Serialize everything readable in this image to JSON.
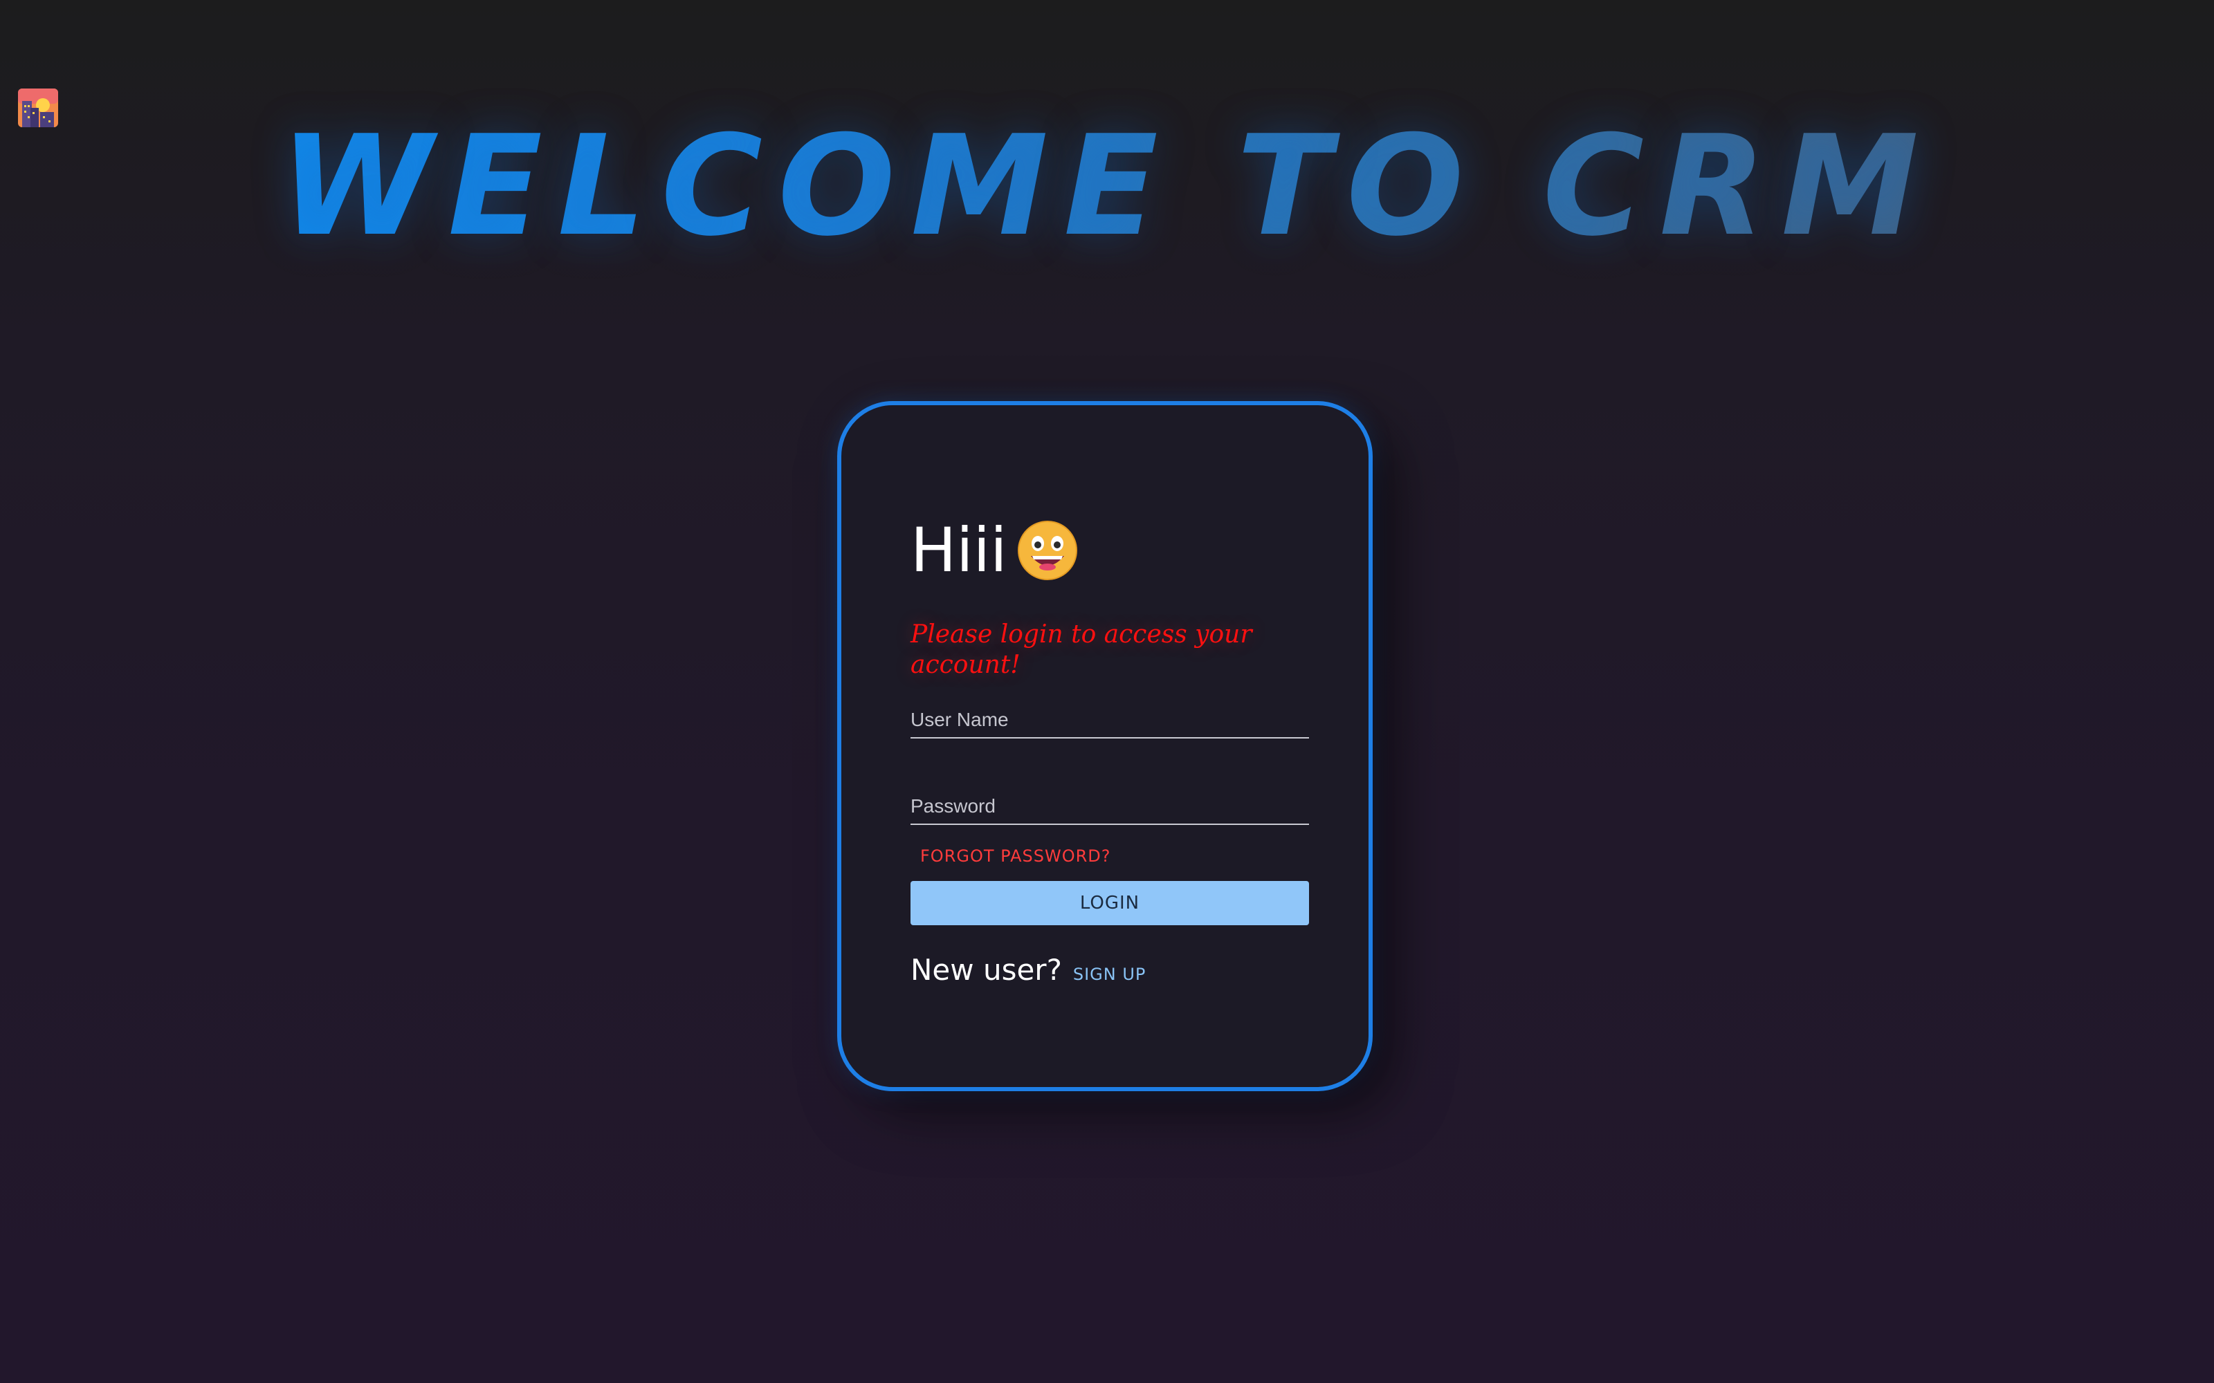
{
  "header": {
    "title": "WELCOME TO CRM",
    "logo_icon": "city-sunset-icon"
  },
  "login_card": {
    "greeting": "Hiii",
    "greeting_icon": "grinning-face-icon",
    "subtitle": "Please login to access your account!",
    "username": {
      "placeholder": "User Name",
      "value": ""
    },
    "password": {
      "placeholder": "Password",
      "value": ""
    },
    "forgot_password_label": "FORGOT PASSWORD?",
    "login_label": "LOGIN",
    "new_user_text": "New user?",
    "signup_label": "SIGN UP"
  },
  "colors": {
    "accent_border": "#1e7fe6",
    "title_gradient_start": "#0d8df2",
    "title_gradient_end": "#4a5a70",
    "error_red": "#ff1010",
    "button_bg": "#90c6f9",
    "link_blue": "#89c3f5"
  }
}
